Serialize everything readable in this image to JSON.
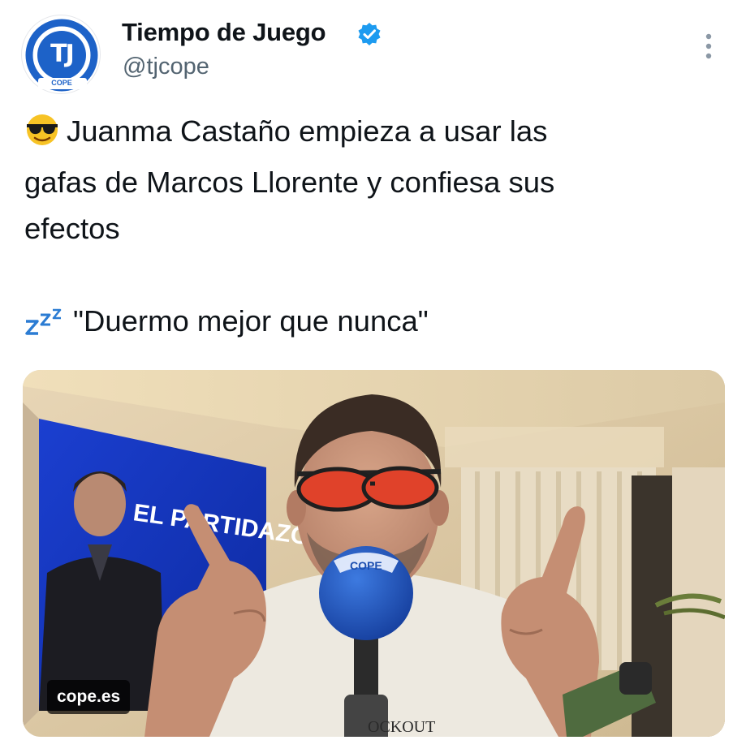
{
  "author": {
    "name": "Tiempo de Juego",
    "handle": "@tjcope",
    "avatar_monogram": "TJ",
    "avatar_subtext": "COPE",
    "verified": true,
    "avatar_color": "#1d62c8",
    "verified_color": "#1d9bf0"
  },
  "tweet": {
    "lines": [
      "Juanma Castaño empieza a usar las",
      "gafas de Marcos Llorente y confiesa sus",
      "efectos",
      "\"Duermo mejor que nunca\""
    ],
    "emoji_1": "smiling-face-with-sunglasses",
    "emoji_2": "zzz"
  },
  "media": {
    "source_badge": "cope.es",
    "screen_text": "EL PARTIDAZO COPE",
    "mic_text": "COPE",
    "shirt_text": "OCKOUT"
  },
  "icons": {
    "more": "more-vertical-icon",
    "verified": "verified-badge-icon"
  }
}
